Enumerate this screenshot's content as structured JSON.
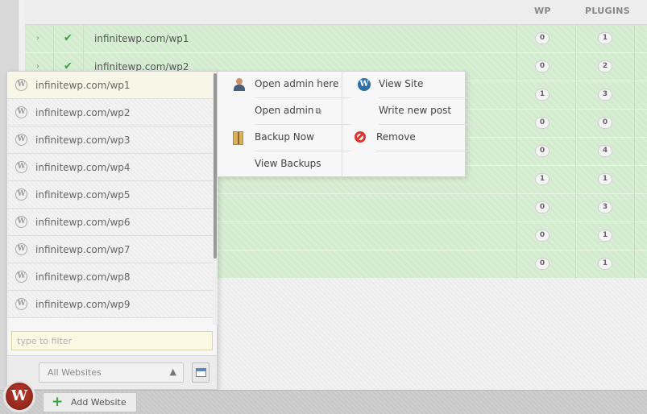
{
  "table": {
    "headers": {
      "wp": "WP",
      "plugins": "PLUGINS"
    },
    "rows": [
      {
        "site": "infinitewp.com/wp1",
        "wp": "0",
        "plugins": "1"
      },
      {
        "site": "infinitewp.com/wp2",
        "wp": "0",
        "plugins": "2"
      },
      {
        "site": "",
        "wp": "1",
        "plugins": "3"
      },
      {
        "site": "",
        "wp": "0",
        "plugins": "0"
      },
      {
        "site": "",
        "wp": "0",
        "plugins": "4"
      },
      {
        "site": "",
        "wp": "1",
        "plugins": "1"
      },
      {
        "site": "",
        "wp": "0",
        "plugins": "3"
      },
      {
        "site": "",
        "wp": "0",
        "plugins": "1"
      },
      {
        "site": "",
        "wp": "0",
        "plugins": "1"
      }
    ]
  },
  "site_panel": {
    "sites": [
      "infinitewp.com/wp1",
      "infinitewp.com/wp2",
      "infinitewp.com/wp3",
      "infinitewp.com/wp4",
      "infinitewp.com/wp5",
      "infinitewp.com/wp6",
      "infinitewp.com/wp7",
      "infinitewp.com/wp8",
      "infinitewp.com/wp9"
    ],
    "filter_placeholder": "type to filter",
    "group_select": "All Websites",
    "wp_glyph": "W"
  },
  "context_menu": {
    "open_admin_here": "Open admin here",
    "open_admin": "Open admin",
    "backup_now": "Backup Now",
    "view_backups": "View Backups",
    "view_site": "View Site",
    "write_new_post": "Write new post",
    "remove": "Remove"
  },
  "bottom_bar": {
    "add_website": "Add Website",
    "logo_glyph": "W"
  }
}
